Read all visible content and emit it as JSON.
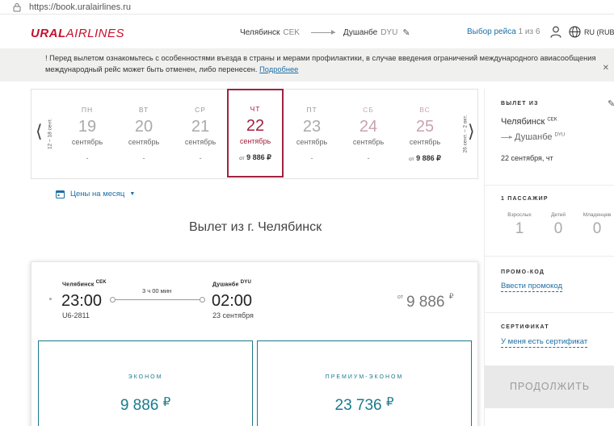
{
  "browser": {
    "url": "https://book.uralairlines.ru"
  },
  "header": {
    "logo_ural": "URAL",
    "logo_airlines": "AIRLINES",
    "origin_city": "Челябинск",
    "origin_code": "CEK",
    "dest_city": "Душанбе",
    "dest_code": "DYU",
    "flight_select_label": "Выбор рейса",
    "flight_select_count": "1 из 6",
    "language": "RU (RUB"
  },
  "notice": {
    "text": "! Перед вылетом ознакомьтесь с особенностями въезда в страны и мерами профилактики, в случае введения ограничений международного авиасообщения международный рейс может быть отменен, либо перенесен.",
    "link": "Подробнее",
    "close": "✕"
  },
  "datestrip": {
    "prev_range": "12 – 18 сент.",
    "next_range": "26 сент. – 2 окт.",
    "days": [
      {
        "dow": "пн",
        "num": "19",
        "month": "сентябрь",
        "price_prefix": "",
        "price": "-"
      },
      {
        "dow": "вт",
        "num": "20",
        "month": "сентябрь",
        "price_prefix": "",
        "price": "-"
      },
      {
        "dow": "ср",
        "num": "21",
        "month": "сентябрь",
        "price_prefix": "",
        "price": "-"
      },
      {
        "dow": "чт",
        "num": "22",
        "month": "сентябрь",
        "price_prefix": "от",
        "price": "9 886 ₽"
      },
      {
        "dow": "пт",
        "num": "23",
        "month": "сентябрь",
        "price_prefix": "",
        "price": "-"
      },
      {
        "dow": "сб",
        "num": "24",
        "month": "сентябрь",
        "price_prefix": "",
        "price": "-"
      },
      {
        "dow": "вс",
        "num": "25",
        "month": "сентябрь",
        "price_prefix": "от",
        "price": "9 886 ₽"
      }
    ]
  },
  "month_prices_label": "Цены на месяц",
  "heading": "Вылет из г. Челябинск",
  "flight": {
    "dep_city": "Челябинск",
    "dep_code": "CEK",
    "dep_time": "23:00",
    "flight_no": "U6-2811",
    "duration": "3 ч 00 мин",
    "arr_city": "Душанбе",
    "arr_code": "DYU",
    "arr_time": "02:00",
    "arr_date": "23 сентября",
    "price_prefix": "от",
    "price": "9 886",
    "currency": "₽",
    "fares": [
      {
        "name": "Эконом",
        "price": "9 886",
        "currency": "₽"
      },
      {
        "name": "Премиум-эконом",
        "price": "23 736",
        "currency": "₽"
      }
    ]
  },
  "sidebar": {
    "departure_title": "Вылет из",
    "origin_city": "Челябинск",
    "origin_code": "CEK",
    "dest_city": "Душанбе",
    "dest_code": "DYU",
    "date": "22 сентября, чт",
    "passengers_title": "1 пассажир",
    "pax": [
      {
        "label": "Взрослых",
        "value": "1"
      },
      {
        "label": "Детей",
        "value": "0"
      },
      {
        "label": "Младенцев",
        "value": "0"
      }
    ],
    "promo_title": "Промо-код",
    "promo_link": "Ввести промокод",
    "cert_title": "Сертификат",
    "cert_link": "У меня есть сертификат",
    "continue_label": "ПРОДОЛЖИТЬ"
  }
}
